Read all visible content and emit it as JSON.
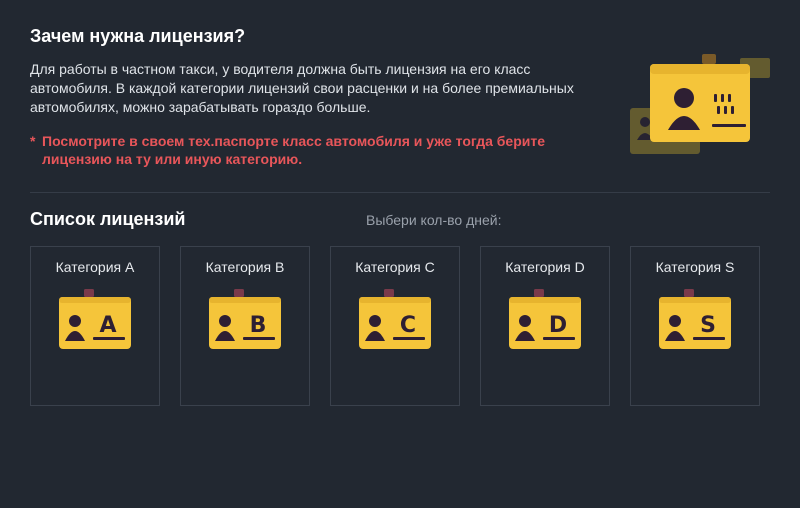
{
  "header": {
    "title": "Зачем нужна лицензия?",
    "description": "Для работы в частном такси, у водителя должна быть лицензия на его класс автомобиля. В каждой категории лицензий свои расценки и на более премиальных автомобилях, можно зарабатывать гораздо больше.",
    "warning_star": "*",
    "warning": "Посмотрите в своем тех.паспорте класс автомобиля и уже тогда берите лицензию на ту или иную категорию.",
    "hero_icon": "license-cards-illustration"
  },
  "licenses": {
    "title": "Список лицензий",
    "days_label": "Выбери кол-во дней:",
    "cards": [
      {
        "label": "Категория A",
        "letter": "A",
        "icon": "license-badge-icon"
      },
      {
        "label": "Категория B",
        "letter": "B",
        "icon": "license-badge-icon"
      },
      {
        "label": "Категория C",
        "letter": "C",
        "icon": "license-badge-icon"
      },
      {
        "label": "Категория D",
        "letter": "D",
        "icon": "license-badge-icon"
      },
      {
        "label": "Категория S",
        "letter": "S",
        "icon": "license-badge-icon"
      }
    ]
  },
  "colors": {
    "background": "#222831",
    "warning": "#e8565a",
    "badge_yellow": "#f5c53a",
    "badge_dark": "#2e1f33"
  }
}
